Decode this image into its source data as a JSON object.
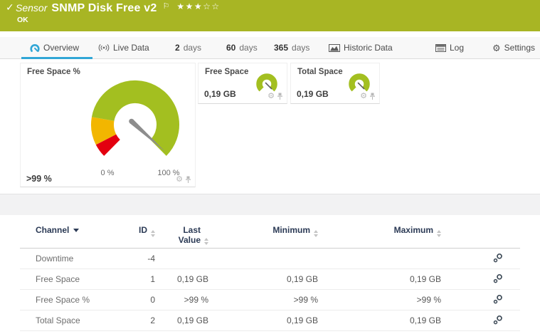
{
  "header": {
    "check_icon": "✓",
    "type_label": "Sensor",
    "title": "SNMP Disk Free v2",
    "flag_icon": "⚐",
    "rating": "★★★☆☆",
    "status_text": "OK"
  },
  "tabs": [
    {
      "label": "Overview",
      "icon": "gauge-icon",
      "active": true
    },
    {
      "label": "Live Data",
      "icon": "live-data-icon"
    },
    {
      "num": "2",
      "label": "days"
    },
    {
      "num": "60",
      "label": "days"
    },
    {
      "num": "365",
      "label": "days"
    },
    {
      "label": "Historic Data",
      "icon": "historic-data-icon"
    },
    {
      "label": "Log",
      "icon": "log-icon"
    },
    {
      "label": "Settings",
      "icon": "gear-icon"
    }
  ],
  "gauges": {
    "main": {
      "title": "Free Space %",
      "value": ">99 %",
      "scale_min": "0 %",
      "scale_max": "100 %",
      "needle_percent": 99,
      "segments": [
        {
          "color": "#e3000f",
          "from": 0,
          "to": 7
        },
        {
          "color": "#f2b600",
          "from": 7,
          "to": 20
        },
        {
          "color": "#a3bf20",
          "from": 20,
          "to": 100
        }
      ]
    },
    "minis": [
      {
        "title": "Free Space",
        "value": "0,19 GB"
      },
      {
        "title": "Total Space",
        "value": "0,19 GB"
      }
    ]
  },
  "table": {
    "columns": [
      "Channel",
      "ID",
      "Last Value",
      "Minimum",
      "Maximum"
    ],
    "rows": [
      {
        "channel": "Downtime",
        "id": "-4",
        "last": "",
        "min": "",
        "max": ""
      },
      {
        "channel": "Free Space",
        "id": "1",
        "last": "0,19 GB",
        "min": "0,19 GB",
        "max": "0,19 GB"
      },
      {
        "channel": "Free Space %",
        "id": "0",
        "last": ">99 %",
        "min": ">99 %",
        "max": ">99 %"
      },
      {
        "channel": "Total Space",
        "id": "2",
        "last": "0,19 GB",
        "min": "0,19 GB",
        "max": "0,19 GB"
      }
    ]
  },
  "colors": {
    "header_bg": "#a8b524",
    "accent_blue": "#31a6d6",
    "gauge_green": "#a3bf20",
    "gauge_yellow": "#f2b600",
    "gauge_red": "#e3000f",
    "table_header_text": "#2b3a55"
  }
}
